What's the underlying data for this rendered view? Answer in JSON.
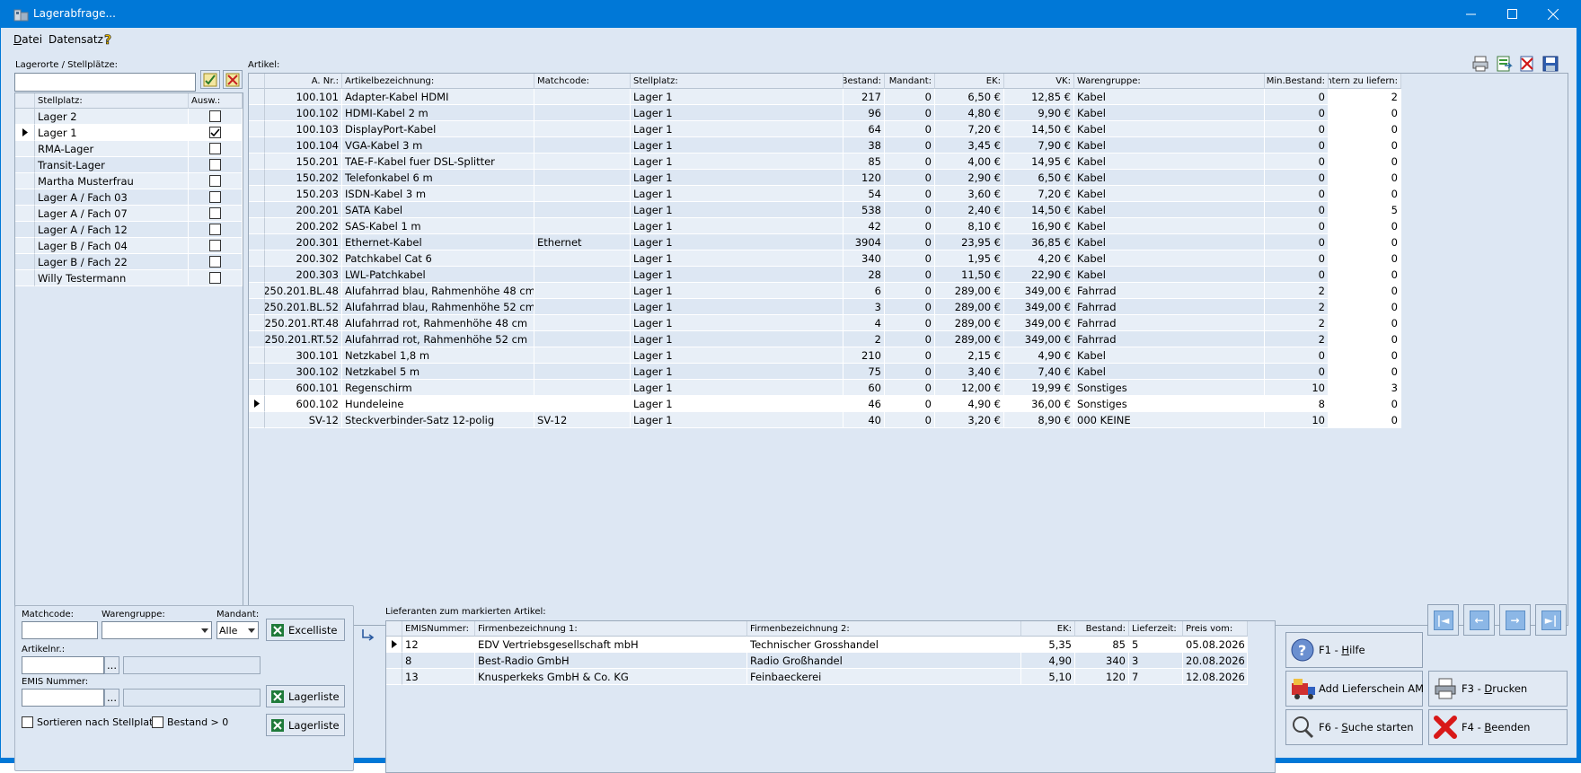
{
  "window": {
    "title": "Lagerabfrage..."
  },
  "menu": {
    "items": [
      {
        "label": "Datei",
        "ul": "D",
        "rest": "atei"
      },
      {
        "label": "Datensatz"
      }
    ]
  },
  "left": {
    "section_label": "Lagerorte / Stellplätze:",
    "search_value": "",
    "columns": [
      "Stellplatz:",
      "Ausw.:"
    ],
    "rows": [
      {
        "name": "Lager 2",
        "checked": false
      },
      {
        "name": "Lager 1",
        "checked": true
      },
      {
        "name": "RMA-Lager",
        "checked": false
      },
      {
        "name": "Transit-Lager",
        "checked": false
      },
      {
        "name": "Martha Musterfrau",
        "checked": false
      },
      {
        "name": "Lager A / Fach 03",
        "checked": false
      },
      {
        "name": "Lager A / Fach 07",
        "checked": false
      },
      {
        "name": "Lager A / Fach 12",
        "checked": false
      },
      {
        "name": "Lager B / Fach 04",
        "checked": false
      },
      {
        "name": "Lager B / Fach 22",
        "checked": false
      },
      {
        "name": "Willy Testermann",
        "checked": false
      }
    ]
  },
  "articles": {
    "section_label": "Artikel:",
    "columns": [
      "A. Nr.:",
      "Artikelbezeichnung:",
      "Matchcode:",
      "Stellplatz:",
      "Bestand:",
      "Mandant:",
      "EK:",
      "VK:",
      "Warengruppe:",
      "Min.Bestand:",
      "Intern zu liefern:"
    ],
    "rows": [
      [
        "100.101",
        "Adapter-Kabel HDMI",
        "",
        "Lager 1",
        "217",
        "0",
        "6,50 €",
        "12,85 €",
        "Kabel",
        "0",
        "2"
      ],
      [
        "100.102",
        "HDMI-Kabel 2 m",
        "",
        "Lager 1",
        "96",
        "0",
        "4,80 €",
        "9,90 €",
        "Kabel",
        "0",
        "0"
      ],
      [
        "100.103",
        "DisplayPort-Kabel",
        "",
        "Lager 1",
        "64",
        "0",
        "7,20 €",
        "14,50 €",
        "Kabel",
        "0",
        "0"
      ],
      [
        "100.104",
        "VGA-Kabel 3 m",
        "",
        "Lager 1",
        "38",
        "0",
        "3,45 €",
        "7,90 €",
        "Kabel",
        "0",
        "0"
      ],
      [
        "150.201",
        "TAE-F-Kabel fuer DSL-Splitter",
        "",
        "Lager 1",
        "85",
        "0",
        "4,00 €",
        "14,95 €",
        "Kabel",
        "0",
        "0"
      ],
      [
        "150.202",
        "Telefonkabel 6 m",
        "",
        "Lager 1",
        "120",
        "0",
        "2,90 €",
        "6,50 €",
        "Kabel",
        "0",
        "0"
      ],
      [
        "150.203",
        "ISDN-Kabel 3 m",
        "",
        "Lager 1",
        "54",
        "0",
        "3,60 €",
        "7,20 €",
        "Kabel",
        "0",
        "0"
      ],
      [
        "200.201",
        "SATA Kabel",
        "",
        "Lager 1",
        "538",
        "0",
        "2,40 €",
        "14,50 €",
        "Kabel",
        "0",
        "5"
      ],
      [
        "200.202",
        "SAS-Kabel 1 m",
        "",
        "Lager 1",
        "42",
        "0",
        "8,10 €",
        "16,90 €",
        "Kabel",
        "0",
        "0"
      ],
      [
        "200.301",
        "Ethernet-Kabel",
        "Ethernet",
        "Lager 1",
        "3904",
        "0",
        "23,95 €",
        "36,85 €",
        "Kabel",
        "0",
        "0"
      ],
      [
        "200.302",
        "Patchkabel Cat 6",
        "",
        "Lager 1",
        "340",
        "0",
        "1,95 €",
        "4,20 €",
        "Kabel",
        "0",
        "0"
      ],
      [
        "200.303",
        "LWL-Patchkabel",
        "",
        "Lager 1",
        "28",
        "0",
        "11,50 €",
        "22,90 €",
        "Kabel",
        "0",
        "0"
      ],
      [
        "250.201.BL.48",
        "Alufahrrad blau, Rahmenhöhe 48 cm",
        "",
        "Lager 1",
        "6",
        "0",
        "289,00 €",
        "349,00 €",
        "Fahrrad",
        "2",
        "0"
      ],
      [
        "250.201.BL.52",
        "Alufahrrad blau, Rahmenhöhe 52 cm",
        "",
        "Lager 1",
        "3",
        "0",
        "289,00 €",
        "349,00 €",
        "Fahrrad",
        "2",
        "0"
      ],
      [
        "250.201.RT.48",
        "Alufahrrad rot, Rahmenhöhe 48 cm",
        "",
        "Lager 1",
        "4",
        "0",
        "289,00 €",
        "349,00 €",
        "Fahrrad",
        "2",
        "0"
      ],
      [
        "250.201.RT.52",
        "Alufahrrad rot, Rahmenhöhe 52 cm",
        "",
        "Lager 1",
        "2",
        "0",
        "289,00 €",
        "349,00 €",
        "Fahrrad",
        "2",
        "0"
      ],
      [
        "300.101",
        "Netzkabel 1,8 m",
        "",
        "Lager 1",
        "210",
        "0",
        "2,15 €",
        "4,90 €",
        "Kabel",
        "0",
        "0"
      ],
      [
        "300.102",
        "Netzkabel 5 m",
        "",
        "Lager 1",
        "75",
        "0",
        "3,40 €",
        "7,40 €",
        "Kabel",
        "0",
        "0"
      ],
      [
        "600.101",
        "Regenschirm",
        "",
        "Lager 1",
        "60",
        "0",
        "12,00 €",
        "19,99 €",
        "Sonstiges",
        "10",
        "3"
      ],
      [
        "600.102",
        "Hundeleine",
        "",
        "Lager 1",
        "46",
        "0",
        "4,90 €",
        "36,00 €",
        "Sonstiges",
        "8",
        "0"
      ],
      [
        "SV-12",
        "Steckverbinder-Satz 12-polig",
        "SV-12",
        "Lager 1",
        "40",
        "0",
        "3,20 €",
        "8,90 €",
        "000 KEINE",
        "10",
        "0"
      ]
    ]
  },
  "filters": {
    "matchcode_label": "Matchcode:",
    "matchcode_value": "",
    "warengruppe_label": "Warengruppe:",
    "warengruppe_value": "",
    "mandant_label": "Mandant:",
    "mandant_value": "Alle",
    "artikelnr_label": "Artikelnr.:",
    "artikelnr_value": "",
    "emis_label": "EMIS Nummer:",
    "emis_value": "",
    "ellipsis": "...",
    "sort_label": "Sortieren nach Stellplatz",
    "bestand_label": "Bestand > 0",
    "excel_button": "Excelliste",
    "lager_button1": "Lagerliste",
    "lager_button2": "Lagerliste"
  },
  "suppliers": {
    "section_label": "Lieferanten zum markierten Artikel:",
    "columns": [
      "EMISNummer:",
      "Firmenbezeichnung 1:",
      "Firmenbezeichnung 2:",
      "EK:",
      "Bestand:",
      "Lieferzeit:",
      "Preis vom:"
    ],
    "rows": [
      [
        "12",
        "EDV Vertriebsgesellschaft mbH",
        "Technischer Grosshandel",
        "5,35",
        "85",
        "5",
        "05.08.2026"
      ],
      [
        "8",
        "Best-Radio GmbH",
        "Radio Großhandel",
        "4,90",
        "340",
        "3",
        "20.08.2026"
      ],
      [
        "13",
        "Knusperkeks GmbH & Co. KG",
        "Feinbaeckerei",
        "5,10",
        "120",
        "7",
        "12.08.2026"
      ]
    ]
  },
  "actions": {
    "help": {
      "prefix": "F1 - ",
      "ul": "H",
      "rest": "ilfe"
    },
    "lieferschein": "Add Lieferschein AM",
    "print": {
      "prefix": "F3 - ",
      "ul": "D",
      "rest": "rucken"
    },
    "search": {
      "prefix": "F6 - ",
      "ul": "S",
      "rest": "uche starten"
    },
    "quit": {
      "prefix": "F4 - ",
      "ul": "B",
      "rest": "eenden"
    }
  },
  "colors": {
    "titlebar": "#0078d7",
    "client": "#dde7f3",
    "row_alt": "#e8eff7",
    "row_selected": "#ffffff"
  }
}
